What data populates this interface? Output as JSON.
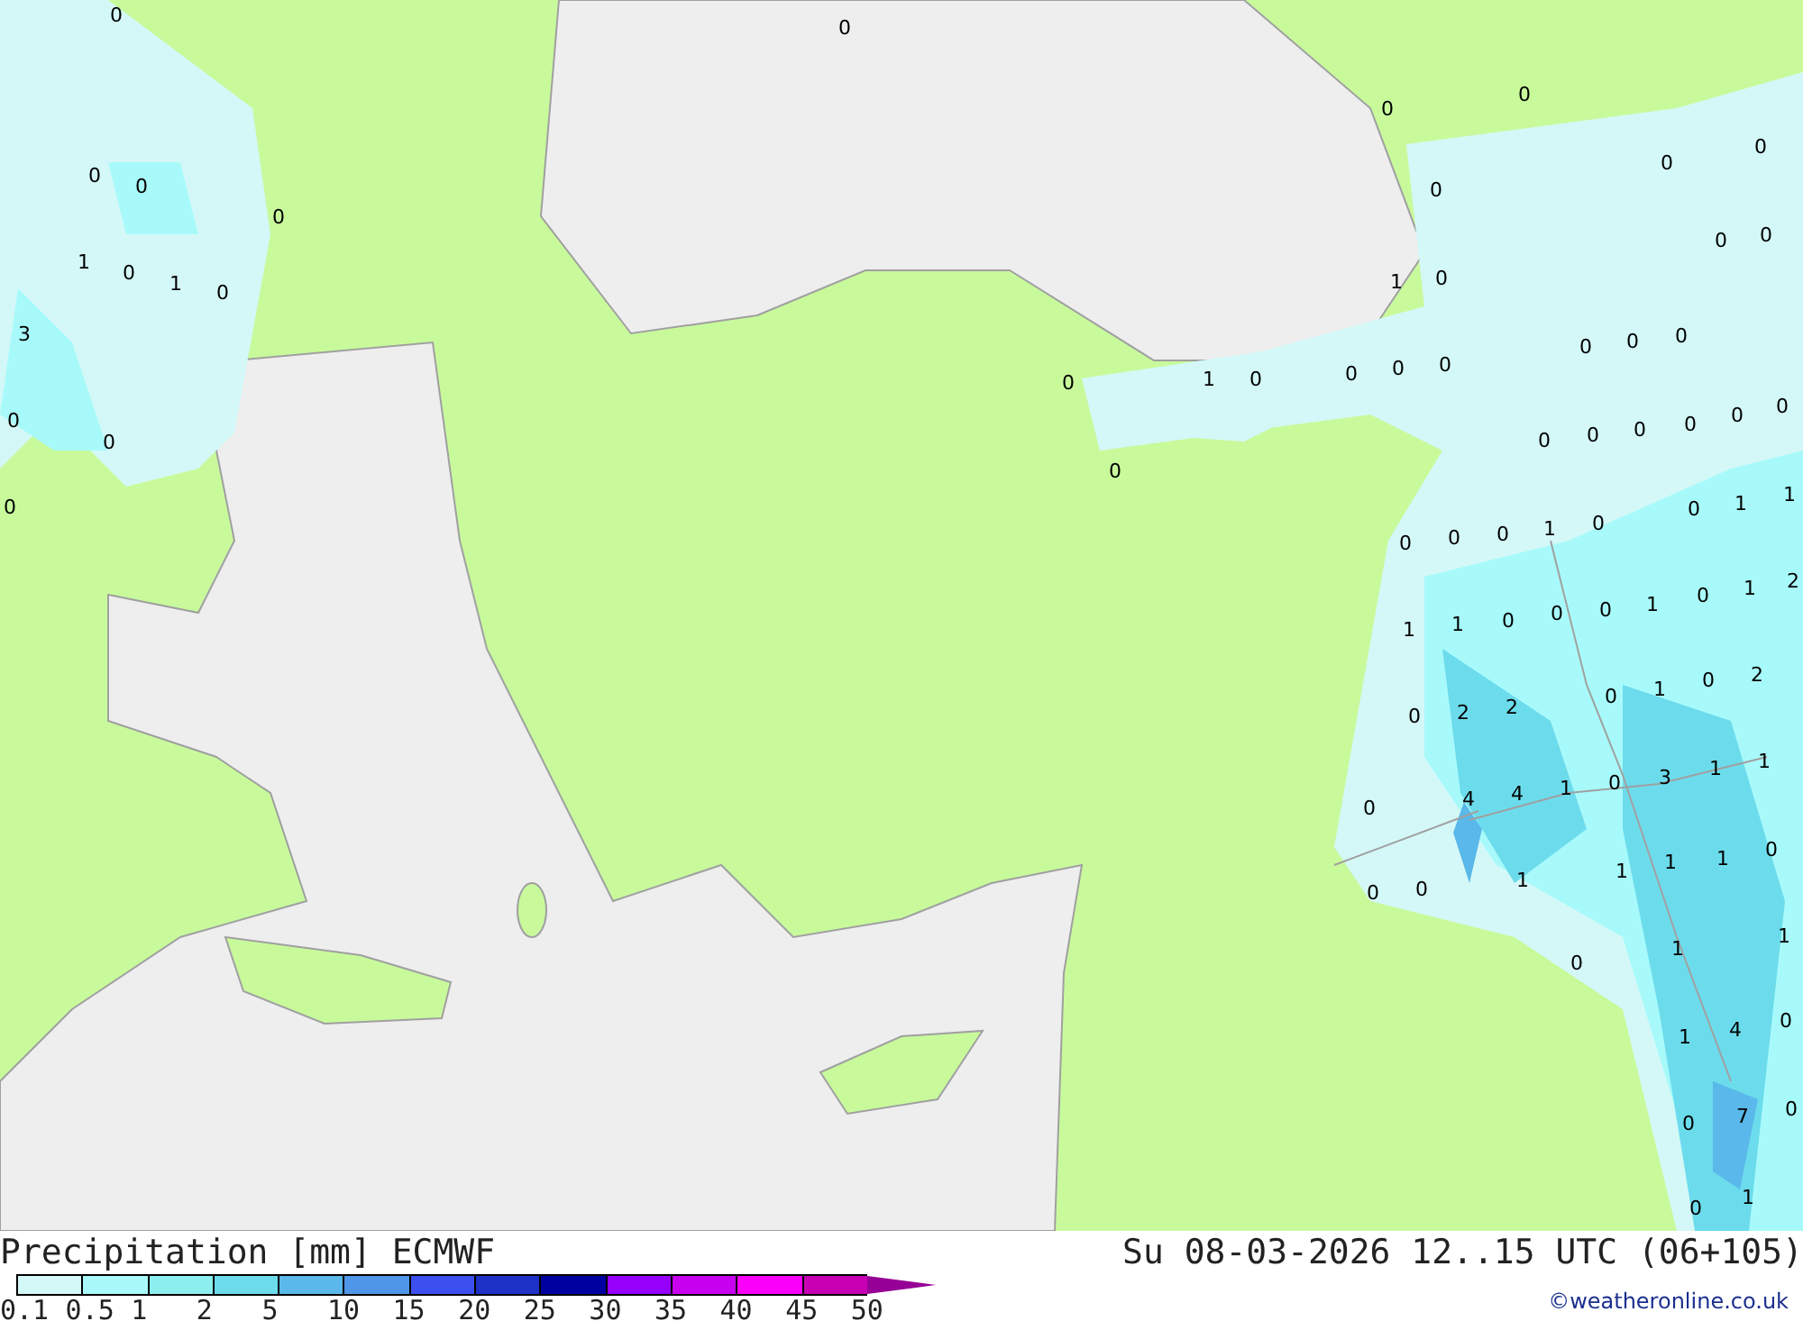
{
  "map": {
    "labels": [
      "0",
      "0",
      "0",
      "0",
      "0",
      "1",
      "0",
      "1",
      "0",
      "3",
      "0",
      "0",
      "0",
      "0",
      "0",
      "0",
      "0",
      "0",
      "0",
      "0",
      "1",
      "0",
      "0",
      "0",
      "0",
      "0",
      "1",
      "0",
      "0",
      "0",
      "0",
      "0",
      "0",
      "0",
      "0",
      "0",
      "0",
      "0",
      "0",
      "1",
      "1",
      "0",
      "0",
      "0",
      "1",
      "0",
      "1",
      "1",
      "0",
      "0",
      "0",
      "1",
      "0",
      "1",
      "2",
      "0",
      "2",
      "2",
      "0",
      "1",
      "0",
      "2",
      "0",
      "4",
      "4",
      "1",
      "0",
      "3",
      "1",
      "1",
      "0",
      "0",
      "1",
      "1",
      "1",
      "1",
      "0",
      "0",
      "1",
      "1",
      "1",
      "4",
      "0",
      "0",
      "7",
      "0",
      "0",
      "1"
    ]
  },
  "legend": {
    "title": "Precipitation [mm] ECMWF",
    "valid_time": "Su 08-03-2026 12..15 UTC (06+105)",
    "swatches": [
      {
        "color": "#d4f8f8"
      },
      {
        "color": "#a8fafa"
      },
      {
        "color": "#8ceeee"
      },
      {
        "color": "#6cdcec"
      },
      {
        "color": "#5ab8ea"
      },
      {
        "color": "#5096e8"
      },
      {
        "color": "#3c50f0"
      },
      {
        "color": "#1e32c8"
      },
      {
        "color": "#0000a0"
      },
      {
        "color": "#9600fa"
      },
      {
        "color": "#c800f0"
      },
      {
        "color": "#fa00fa"
      },
      {
        "color": "#c800b4"
      }
    ],
    "arrow": {
      "color": "#960096"
    },
    "ticks": [
      "0.1",
      "0.5",
      "1",
      "2",
      "5",
      "10",
      "15",
      "20",
      "25",
      "30",
      "35",
      "40",
      "45",
      "50"
    ],
    "credit": "©weatheronline.co.uk"
  }
}
